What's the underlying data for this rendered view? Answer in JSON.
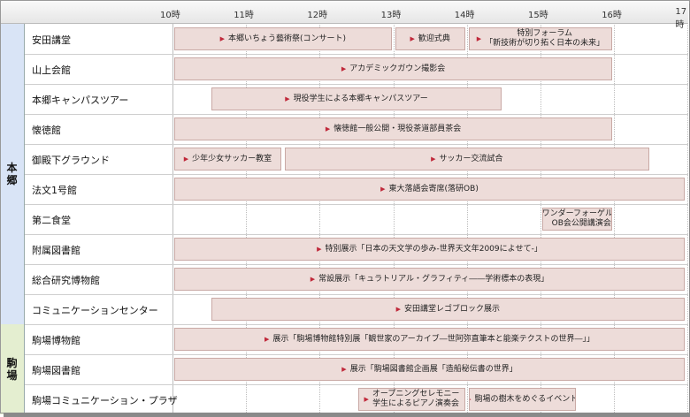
{
  "colors": {
    "area_hongo": "#d9e4f6",
    "area_komaba": "#e4eed0",
    "event_fill": "#eddcd9",
    "arrow": "#c0283a"
  },
  "hours": [
    "10時",
    "11時",
    "12時",
    "13時",
    "14時",
    "15時",
    "16時",
    "17時"
  ],
  "areas": [
    {
      "label": "本\n郷"
    },
    {
      "label": "駒\n場"
    }
  ],
  "venues": [
    {
      "name": "安田講堂",
      "events": [
        {
          "lines": [
            "本郷いちょう藝術祭(コンサート)"
          ],
          "start": "10:00",
          "end": "13:00"
        },
        {
          "lines": [
            "歓迎式典"
          ],
          "start": "13:00",
          "end": "14:00"
        },
        {
          "lines": [
            "特別フォーラム",
            "「新技術が切り拓く日本の未来」"
          ],
          "start": "14:00",
          "end": "16:00"
        }
      ]
    },
    {
      "name": "山上会館",
      "events": [
        {
          "lines": [
            "アカデミックガウン撮影会"
          ],
          "start": "10:00",
          "end": "16:00"
        }
      ]
    },
    {
      "name": "本郷キャンパスツアー",
      "events": [
        {
          "lines": [
            "現役学生による本郷キャンパスツアー"
          ],
          "start": "10:30",
          "end": "14:30"
        }
      ]
    },
    {
      "name": "懐徳館",
      "events": [
        {
          "lines": [
            "懐徳館一般公開・現役茶道部員茶会"
          ],
          "start": "10:00",
          "end": "16:00"
        }
      ]
    },
    {
      "name": "御殿下グラウンド",
      "events": [
        {
          "lines": [
            "少年少女サッカー教室"
          ],
          "start": "10:00",
          "end": "11:30"
        },
        {
          "lines": [
            "サッカー交流試合"
          ],
          "start": "11:30",
          "end": "16:30"
        }
      ]
    },
    {
      "name": "法文1号館",
      "events": [
        {
          "lines": [
            "東大落語会寄席(落研OB)"
          ],
          "start": "10:00",
          "end": "17:00"
        }
      ]
    },
    {
      "name": "第二食堂",
      "events": [
        {
          "lines": [
            "ワンダーフォーゲル部",
            "OB会公開講演会"
          ],
          "start": "15:00",
          "end": "16:00"
        }
      ]
    },
    {
      "name": "附属図書館",
      "events": [
        {
          "lines": [
            "特別展示「日本の天文学の歩み-世界天文年2009によせて-」"
          ],
          "start": "10:00",
          "end": "17:00"
        }
      ]
    },
    {
      "name": "総合研究博物館",
      "events": [
        {
          "lines": [
            "常設展示「キュラトリアル・グラフィティ――学術標本の表現」"
          ],
          "start": "10:00",
          "end": "17:00"
        }
      ]
    },
    {
      "name": "コミュニケーションセンター",
      "events": [
        {
          "lines": [
            "安田講堂レゴブロック展示"
          ],
          "start": "10:30",
          "end": "17:00"
        }
      ]
    },
    {
      "name": "駒場博物館",
      "events": [
        {
          "lines": [
            "展示「駒場博物館特別展「観世家のアーカイブ―世阿弥直筆本と能楽テクストの世界―」」"
          ],
          "start": "10:00",
          "end": "17:00"
        }
      ]
    },
    {
      "name": "駒場図書館",
      "events": [
        {
          "lines": [
            "展示「駒場図書館企画展「造船秘伝書の世界」"
          ],
          "start": "10:00",
          "end": "17:00"
        }
      ]
    },
    {
      "name": "駒場コミュニケーション・プラザ",
      "events": [
        {
          "lines": [
            "オープニングセレモニー",
            "学生によるピアノ演奏会"
          ],
          "start": "12:30",
          "end": "14:00"
        },
        {
          "lines": [
            "駒場の樹木をめぐるイベント"
          ],
          "start": "14:00",
          "end": "15:30"
        }
      ]
    }
  ]
}
